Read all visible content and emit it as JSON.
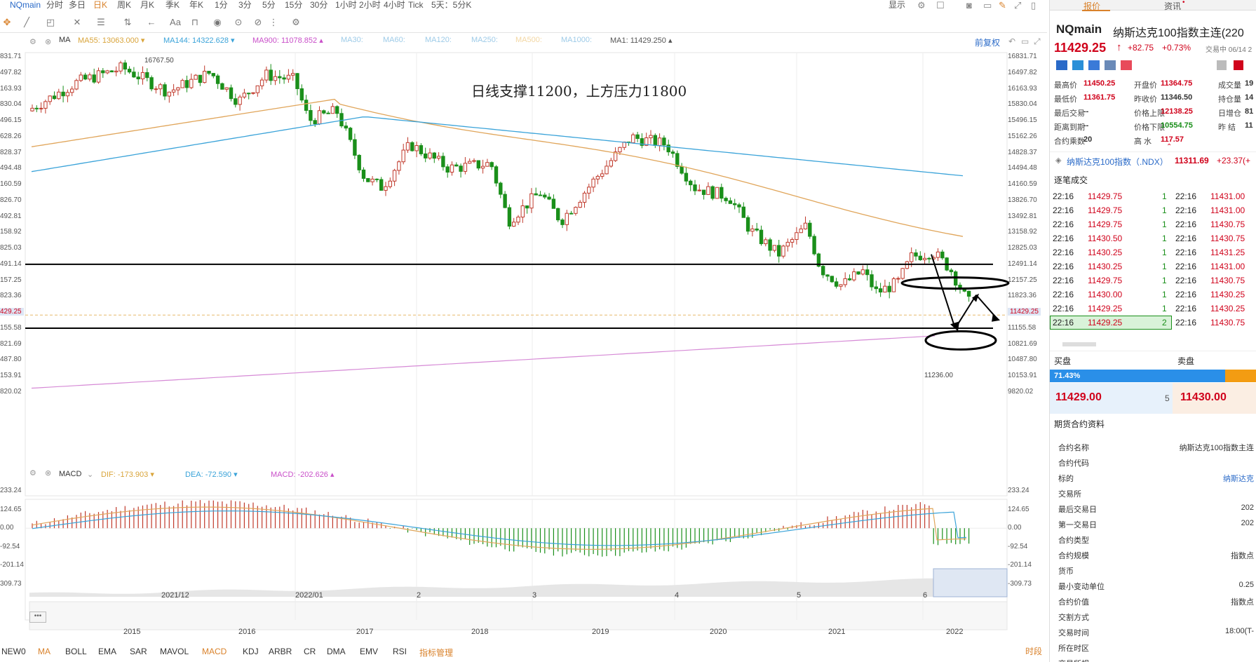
{
  "toolbar": {
    "symbol": "NQmain",
    "periods": [
      "分时",
      "多日",
      "日K",
      "周K",
      "月K",
      "季K",
      "年K",
      "1分",
      "3分",
      "5分",
      "15分",
      "30分",
      "1小时",
      "2小时",
      "4小时",
      "Tick",
      "5天：5分K"
    ],
    "active_period": "日K",
    "display_label": "显示"
  },
  "chart_header": {
    "ma_title": "MA",
    "ma_values": [
      {
        "text": "MA55: 13063.000 ▾",
        "color": "#d9a43a"
      },
      {
        "text": "MA144: 14322.628 ▾",
        "color": "#3aa3d9"
      },
      {
        "text": "MA900: 11078.852 ▴",
        "color": "#c94fc9"
      },
      {
        "text": "MA30:",
        "color": "#9ecbe8"
      },
      {
        "text": "MA60:",
        "color": "#9ecbe8"
      },
      {
        "text": "MA120:",
        "color": "#9ecbe8"
      },
      {
        "text": "MA250:",
        "color": "#9ecbe8"
      },
      {
        "text": "MA500:",
        "color": "#f3d7a3"
      },
      {
        "text": "MA1000:",
        "color": "#9ecbe8"
      },
      {
        "text": "MA1: 11429.250 ▴",
        "color": "#555555"
      }
    ],
    "restore": "前复权",
    "annotation": "日线支撑11200，上方压力11800",
    "high_label": "16767.50",
    "low_label": "11236.00"
  },
  "price_axis": [
    "16831.71",
    "16497.82",
    "16163.93",
    "15830.04",
    "15496.15",
    "15162.26",
    "14828.37",
    "14494.48",
    "14160.59",
    "13826.70",
    "13492.81",
    "13158.92",
    "12825.03",
    "12491.14",
    "12157.25",
    "11823.36",
    "11429.25",
    "11155.58",
    "10821.69",
    "10487.80",
    "10153.91",
    "9820.02"
  ],
  "price_axis_left": [
    "831.71",
    "497.82",
    "163.93",
    "830.04",
    "496.15",
    "628.26",
    "828.37",
    "494.48",
    "160.59",
    "826.70",
    "492.81",
    "158.92",
    "825.03",
    "491.14",
    "157.25",
    "823.36",
    "429.25",
    "155.58",
    "821.69",
    "487.80",
    "153.91",
    "820.02"
  ],
  "macd": {
    "title": "MACD",
    "dif": "DIF: -173.903 ▾",
    "dea": "DEA: -72.590 ▾",
    "macd_val": "MACD: -202.626 ▴",
    "axis": [
      "233.24",
      "124.65",
      "0.00",
      "-92.54",
      "-201.14",
      "-309.73"
    ],
    "axis_left": [
      "233.24",
      "124.65",
      "0.00",
      "-92.54",
      "-201.14",
      "309.73"
    ]
  },
  "time_axis": [
    "2021/12",
    "2022/01",
    "2",
    "3",
    "4",
    "5",
    "6"
  ],
  "overview_axis": [
    "2015",
    "2016",
    "2017",
    "2018",
    "2019",
    "2020",
    "2021",
    "2022"
  ],
  "indicator_tabs": [
    "NEW0",
    "MA",
    "BOLL",
    "EMA",
    "SAR",
    "MAVOL",
    "MACD",
    "KDJ",
    "ARBR",
    "CR",
    "DMA",
    "EMV",
    "RSI",
    "指标管理"
  ],
  "indicator_selected": [
    "MA",
    "MACD"
  ],
  "time_period_btn": "时段",
  "chart_data": {
    "type": "candlestick",
    "title": "日线支撑11200，上方压力11800",
    "ylim": [
      9820.02,
      16831.71
    ],
    "support": 11200,
    "resistance": 11800,
    "h_lines": [
      12491.14,
      11155.58
    ],
    "last_price": 11429.25,
    "x_range": [
      "2021/11",
      "2022/06"
    ]
  },
  "right": {
    "tabs": [
      "报价",
      "资讯"
    ],
    "code": "NQmain",
    "name": "纳斯达克100指数主连(220",
    "price": "11429.25",
    "change": "+82.75",
    "change_pct": "+0.73%",
    "trade_status": "交易中 06/14 2",
    "stats": [
      {
        "k": "最高价",
        "v": "11450.25",
        "c": "red"
      },
      {
        "k": "开盘价",
        "v": "11364.75",
        "c": "red"
      },
      {
        "k": "成交量",
        "v": "19",
        "c": "dark"
      },
      {
        "k": "最低价",
        "v": "11361.75",
        "c": "red"
      },
      {
        "k": "昨收价",
        "v": "11346.50",
        "c": "dark"
      },
      {
        "k": "持仓量",
        "v": "14",
        "c": "dark"
      },
      {
        "k": "最后交易",
        "v": "--",
        "c": "dark"
      },
      {
        "k": "价格上限",
        "v": "12138.25",
        "c": "red"
      },
      {
        "k": "日增仓",
        "v": "81",
        "c": "dark"
      },
      {
        "k": "距离到期",
        "v": "--",
        "c": "dark"
      },
      {
        "k": "价格下限",
        "v": "10554.75",
        "c": "green"
      },
      {
        "k": "昨 结",
        "v": "11",
        "c": "dark"
      },
      {
        "k": "合约乘数",
        "v": "20",
        "c": "dark"
      },
      {
        "k": "高 水",
        "v": "117.57",
        "c": "red"
      },
      {
        "k": "",
        "v": "",
        "c": "dark"
      }
    ],
    "related_name": "纳斯达克100指数（.NDX）",
    "related_price": "11311.69",
    "related_change": "+23.37(+",
    "ticks_title": "逐笔成交",
    "ticks": [
      {
        "t1": "22:16",
        "p1": "11429.75",
        "v1": "1",
        "t2": "22:16",
        "p2": "11431.00"
      },
      {
        "t1": "22:16",
        "p1": "11429.75",
        "v1": "1",
        "t2": "22:16",
        "p2": "11431.00"
      },
      {
        "t1": "22:16",
        "p1": "11429.75",
        "v1": "1",
        "t2": "22:16",
        "p2": "11430.75"
      },
      {
        "t1": "22:16",
        "p1": "11430.50",
        "v1": "1",
        "t2": "22:16",
        "p2": "11430.75"
      },
      {
        "t1": "22:16",
        "p1": "11430.25",
        "v1": "1",
        "t2": "22:16",
        "p2": "11431.25"
      },
      {
        "t1": "22:16",
        "p1": "11430.25",
        "v1": "1",
        "t2": "22:16",
        "p2": "11431.00"
      },
      {
        "t1": "22:16",
        "p1": "11429.75",
        "v1": "1",
        "t2": "22:16",
        "p2": "11430.75"
      },
      {
        "t1": "22:16",
        "p1": "11430.00",
        "v1": "1",
        "t2": "22:16",
        "p2": "11430.25"
      },
      {
        "t1": "22:16",
        "p1": "11429.25",
        "v1": "1",
        "t2": "22:16",
        "p2": "11430.25"
      },
      {
        "t1": "22:16",
        "p1": "11429.25",
        "v1": "2",
        "t2": "22:16",
        "p2": "11430.75"
      }
    ],
    "buy_label": "买盘",
    "sell_label": "卖盘",
    "buy_ratio": "71.43%",
    "bid_price": "11429.00",
    "bid_vol": "5",
    "ask_price": "11430.00",
    "contract_title": "期货合约资料",
    "contract": [
      {
        "k": "合约名称",
        "v": "纳斯达克100指数主连"
      },
      {
        "k": "合约代码",
        "v": ""
      },
      {
        "k": "标的",
        "v": "纳斯达克"
      },
      {
        "k": "交易所",
        "v": ""
      },
      {
        "k": "最后交易日",
        "v": "202"
      },
      {
        "k": "第一交易日",
        "v": "202"
      },
      {
        "k": "合约类型",
        "v": ""
      },
      {
        "k": "合约规模",
        "v": "指数点"
      },
      {
        "k": "货币",
        "v": ""
      },
      {
        "k": "最小变动单位",
        "v": "0.25"
      },
      {
        "k": "合约价值",
        "v": "指数点"
      },
      {
        "k": "交割方式",
        "v": ""
      },
      {
        "k": "交易时间",
        "v": "18:00(T-"
      },
      {
        "k": "所在时区",
        "v": ""
      },
      {
        "k": "交易所规",
        "v": ""
      }
    ]
  }
}
